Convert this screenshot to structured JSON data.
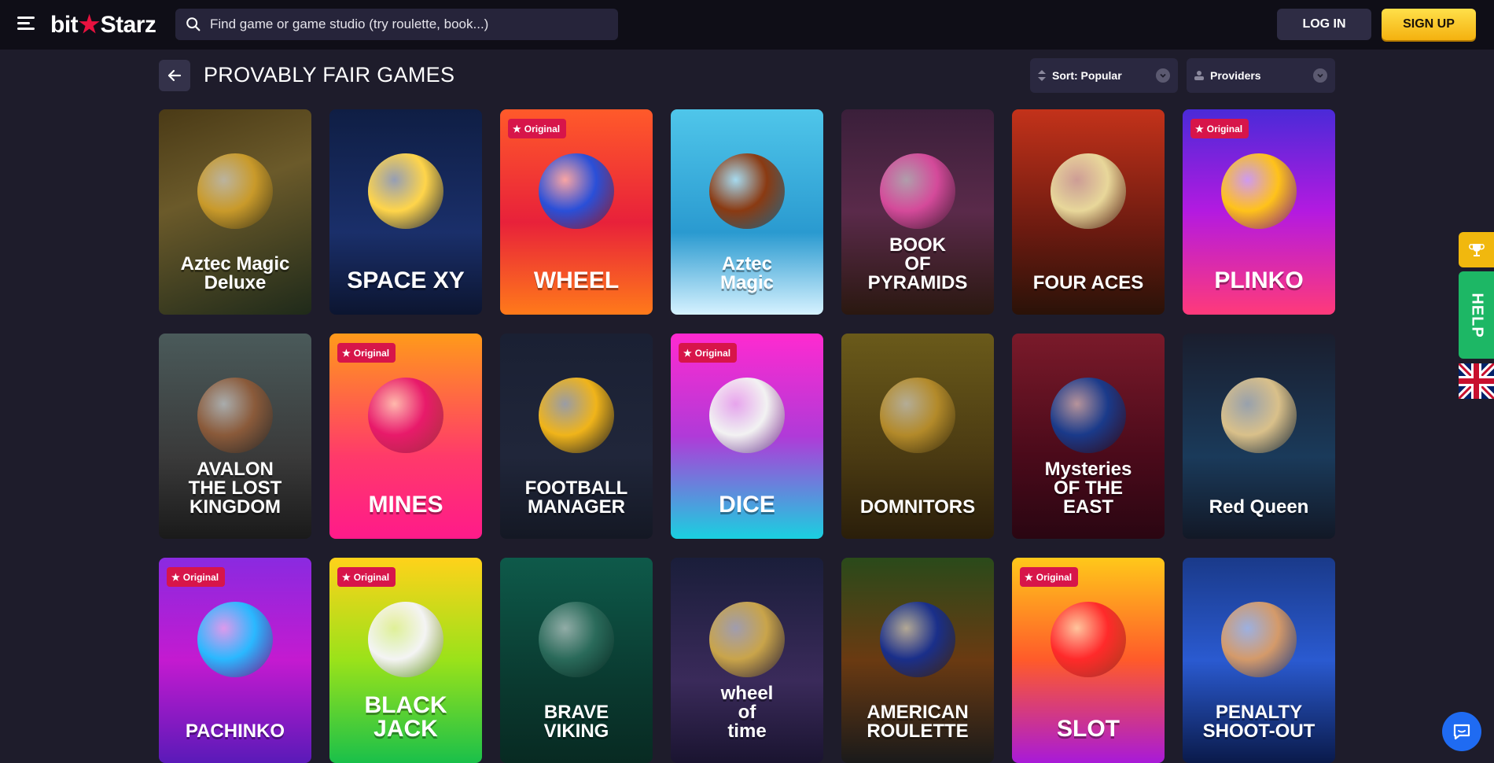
{
  "header": {
    "logo_text_left": "bit",
    "logo_star": "★",
    "logo_text_right": "Starz",
    "search_placeholder": "Find game or game studio (try roulette, book...)",
    "login_label": "LOG IN",
    "signup_label": "SIGN UP"
  },
  "page": {
    "title": "PROVABLY FAIR GAMES",
    "sort_label": "Sort: Popular",
    "providers_label": "Providers"
  },
  "badge_label": "Original",
  "games": [
    {
      "name": "Aztec Magic\nDeluxe",
      "original": false,
      "bg": "linear-gradient(160deg,#4a3a16,#6b5a2a 40%,#1f2a1a)",
      "art": "#c99a2a",
      "small": true
    },
    {
      "name": "SPACE XY",
      "original": false,
      "bg": "linear-gradient(180deg,#0f1e44,#1a2f6a 60%,#0c1530)",
      "art": "#ffd54a",
      "small": false
    },
    {
      "name": "WHEEL",
      "original": true,
      "bg": "linear-gradient(180deg,#ff5a2a,#e8213a 55%,#ff7a1a)",
      "art": "#2a4fd8",
      "small": false
    },
    {
      "name": "Aztec\nMagic",
      "original": false,
      "bg": "linear-gradient(180deg,#4fc6ea,#2a9ad0 60%,#d6f2ff)",
      "art": "#8a3a12",
      "small": true
    },
    {
      "name": "BOOK\nOF\nPYRAMIDS",
      "original": false,
      "bg": "linear-gradient(180deg,#3a1f3a,#5a2a4a 50%,#2a1810)",
      "art": "#d44a9a",
      "small": true
    },
    {
      "name": "FOUR ACES",
      "original": false,
      "bg": "linear-gradient(180deg,#c3321a,#6a1a10 60%,#2a1208)",
      "art": "#e8d79a",
      "small": true
    },
    {
      "name": "PLINKO",
      "original": true,
      "bg": "linear-gradient(180deg,#4a2ad8,#b41ae0 50%,#ff3a7a)",
      "art": "#ffc21a",
      "small": false
    },
    {
      "name": "AVALON\nTHE LOST KINGDOM",
      "original": false,
      "bg": "linear-gradient(180deg,#4a5a5a,#3a3a3a 60%,#1a1a1a)",
      "art": "#8a5a3a",
      "small": true
    },
    {
      "name": "MINES",
      "original": true,
      "bg": "linear-gradient(180deg,#ff9a1a,#ff3a6a 60%,#ff1a8a)",
      "art": "#e81a6a",
      "small": false
    },
    {
      "name": "FOOTBALL\nMANAGER",
      "original": false,
      "bg": "linear-gradient(180deg,#1a2033,#20263a 60%,#141824)",
      "art": "#f0b41a",
      "small": true
    },
    {
      "name": "DICE",
      "original": true,
      "bg": "linear-gradient(180deg,#ff2ad0,#b03ad8 50%,#1ad0e0)",
      "art": "#f2f2f2",
      "small": false
    },
    {
      "name": "DOMNITORS",
      "original": false,
      "bg": "linear-gradient(180deg,#6a5a1a,#4a3a12 60%,#2a1e0a)",
      "art": "#b38a2a",
      "small": true
    },
    {
      "name": "Mysteries\nOF THE\nEAST",
      "original": false,
      "bg": "linear-gradient(180deg,#7a1a2a,#4a0a1a 60%,#2a0612)",
      "art": "#1a3a8a",
      "small": true
    },
    {
      "name": "Red Queen",
      "original": false,
      "bg": "linear-gradient(180deg,#1a1e2e,#1a3a5a 60%,#121826)",
      "art": "#d9c08a",
      "small": true
    },
    {
      "name": "PACHINKO",
      "original": true,
      "bg": "linear-gradient(180deg,#8a2ae0,#c41ad0 50%,#5a1ab8)",
      "art": "#2ab8ff",
      "small": true
    },
    {
      "name": "BLACK\nJACK",
      "original": true,
      "bg": "linear-gradient(180deg,#ffd21a,#9ae21a 50%,#1ac04a)",
      "art": "#f4f4f4",
      "small": false
    },
    {
      "name": "BRAVE\nVIKING",
      "original": false,
      "bg": "linear-gradient(180deg,#0e5a4a,#0a3a30 60%,#082a22)",
      "art": "#2a6a5a",
      "small": true
    },
    {
      "name": "wheel\nof\ntime",
      "original": false,
      "bg": "linear-gradient(180deg,#1a1e3a,#3a2a5a 60%,#1a1430)",
      "art": "#c9a44a",
      "small": true
    },
    {
      "name": "AMERICAN\nROULETTE",
      "original": false,
      "bg": "linear-gradient(180deg,#2a4a1a,#6a3a12 50%,#1a1a1a)",
      "art": "#1a2f8a",
      "small": true
    },
    {
      "name": "SLOT",
      "original": true,
      "bg": "linear-gradient(180deg,#ffc81a,#ff5a2a 50%,#a81ad8)",
      "art": "#ff2a2a",
      "small": false
    },
    {
      "name": "PENALTY\nSHOOT-OUT",
      "original": false,
      "bg": "linear-gradient(180deg,#1a3a8a,#2a5ad0 50%,#0a1a4a)",
      "art": "#d49a6a",
      "small": true
    }
  ],
  "widgets": {
    "help_label": "HELP"
  },
  "icons": {
    "search": "search-icon",
    "back": "arrow-left-icon",
    "chevron": "chevron-down-icon",
    "trophy": "trophy-icon",
    "flag": "uk-flag-icon",
    "chat": "chat-icon"
  }
}
